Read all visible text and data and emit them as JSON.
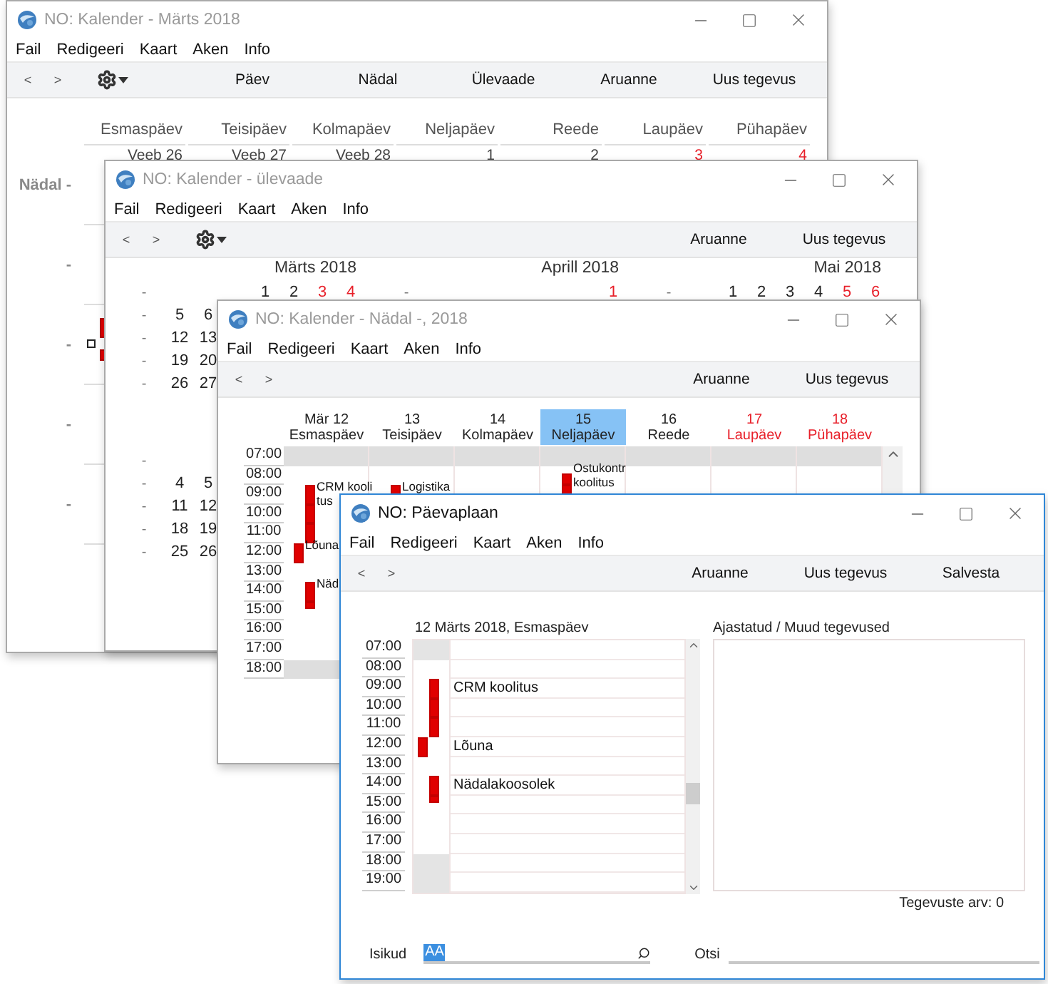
{
  "month_window": {
    "title": "NO: Kalender - Märts 2018",
    "active": false,
    "menu": [
      "Fail",
      "Redigeeri",
      "Kaart",
      "Aken",
      "Info"
    ],
    "toolbar": {
      "nav": [
        "<",
        ">"
      ],
      "settings_menu": true,
      "buttons": [
        "Päev",
        "Nädal",
        "Ülevaade",
        "Aruanne",
        "Uus tegevus"
      ]
    },
    "day_headers": [
      "Esmaspäev",
      "Teisipäev",
      "Kolmapäev",
      "Neljapäev",
      "Reede",
      "Laupäev",
      "Pühapäev"
    ],
    "weeks": [
      {
        "label": "Nädal -",
        "has_events": false,
        "cells": [
          {
            "text": "Veeb 26",
            "weekend": false
          },
          {
            "text": "Veeb 27",
            "weekend": false
          },
          {
            "text": "Veeb 28",
            "weekend": false
          },
          {
            "text": "1",
            "weekend": false
          },
          {
            "text": "2",
            "weekend": false
          },
          {
            "text": "3",
            "weekend": true
          },
          {
            "text": "4",
            "weekend": true
          }
        ]
      },
      {
        "label": "-",
        "has_events": false
      },
      {
        "label": "-",
        "has_events": true
      },
      {
        "label": "-",
        "has_events": false
      },
      {
        "label": "-",
        "has_events": false
      }
    ]
  },
  "overview_window": {
    "title": "NO: Kalender - ülevaade",
    "active": false,
    "menu": [
      "Fail",
      "Redigeeri",
      "Kaart",
      "Aken",
      "Info"
    ],
    "toolbar": {
      "nav": [
        "<",
        ">"
      ],
      "settings_menu": true,
      "buttons": [
        "Aruanne",
        "Uus tegevus"
      ]
    },
    "months": [
      {
        "title": "Märts 2018",
        "weeks": [
          {
            "label": "-",
            "days": [
              {
                "text": "1",
                "weekend": false
              },
              {
                "text": "2",
                "weekend": false
              },
              {
                "text": "3",
                "weekend": true
              },
              {
                "text": "4",
                "weekend": true
              }
            ]
          },
          {
            "label": "-",
            "days": [
              {
                "text": "5",
                "weekend": false
              },
              {
                "text": "6",
                "weekend": false
              }
            ]
          },
          {
            "label": "-",
            "days": [
              {
                "text": "12",
                "weekend": false
              },
              {
                "text": "13",
                "weekend": false
              }
            ]
          },
          {
            "label": "-",
            "days": [
              {
                "text": "19",
                "weekend": false
              },
              {
                "text": "20",
                "weekend": false
              }
            ]
          },
          {
            "label": "-",
            "days": [
              {
                "text": "26",
                "weekend": false
              },
              {
                "text": "27",
                "weekend": false
              }
            ]
          }
        ]
      },
      {
        "title": "Aprill 2018",
        "weeks": [
          {
            "label": "-",
            "days": [
              {
                "text": "1",
                "weekend": true
              }
            ]
          }
        ]
      },
      {
        "title": "Mai 2018",
        "weeks": [
          {
            "label": "-",
            "days": [
              {
                "text": "1",
                "weekend": false
              },
              {
                "text": "2",
                "weekend": false
              },
              {
                "text": "3",
                "weekend": false
              },
              {
                "text": "4",
                "weekend": false
              },
              {
                "text": "5",
                "weekend": true
              },
              {
                "text": "6",
                "weekend": true
              }
            ]
          }
        ]
      },
      {
        "weeks": [
          {
            "label": "-"
          },
          {
            "label": "-",
            "days": [
              {
                "text": "4",
                "weekend": false
              },
              {
                "text": "5",
                "weekend": false
              }
            ]
          },
          {
            "label": "-",
            "days": [
              {
                "text": "11",
                "weekend": false
              },
              {
                "text": "12",
                "weekend": false
              }
            ]
          },
          {
            "label": "-",
            "days": [
              {
                "text": "18",
                "weekend": false
              },
              {
                "text": "19",
                "weekend": false
              }
            ]
          },
          {
            "label": "-",
            "days": [
              {
                "text": "25",
                "weekend": false
              },
              {
                "text": "26",
                "weekend": false
              }
            ]
          }
        ]
      }
    ]
  },
  "week_window": {
    "title": "NO: Kalender - Nädal -, 2018",
    "active": false,
    "menu": [
      "Fail",
      "Redigeeri",
      "Kaart",
      "Aken",
      "Info"
    ],
    "toolbar": {
      "nav": [
        "<",
        ">"
      ],
      "settings_menu": false,
      "buttons": [
        "Aruanne",
        "Uus tegevus"
      ]
    },
    "times": [
      {
        "time": "07:00",
        "shaded": true
      },
      {
        "time": "08:00",
        "shaded": false
      },
      {
        "time": "09:00",
        "shaded": false
      },
      {
        "time": "10:00",
        "shaded": false
      },
      {
        "time": "11:00",
        "shaded": false
      },
      {
        "time": "12:00",
        "shaded": false
      },
      {
        "time": "13:00",
        "shaded": false
      },
      {
        "time": "14:00",
        "shaded": false
      },
      {
        "time": "15:00",
        "shaded": false
      },
      {
        "time": "16:00",
        "shaded": false
      },
      {
        "time": "17:00",
        "shaded": false
      },
      {
        "time": "18:00",
        "shaded": true
      }
    ],
    "days": [
      {
        "date": "Mär 12",
        "name": "Esmaspäev",
        "weekend": false,
        "selected": false,
        "slots": [
          {
            "kind": "none"
          },
          {
            "kind": "none"
          },
          {
            "kind": "full",
            "lines": [
              "CRM kooli",
              "tus"
            ]
          },
          {
            "kind": "full"
          },
          {
            "kind": "full"
          },
          {
            "kind": "side",
            "lines": [
              "Lõuna"
            ]
          },
          {
            "kind": "none"
          },
          {
            "kind": "full",
            "lines": [
              "Näd"
            ]
          },
          {
            "kind": "top"
          }
        ]
      },
      {
        "date": "13",
        "name": "Teisipäev",
        "weekend": false,
        "selected": false,
        "slots": [
          {
            "kind": "none"
          },
          {
            "kind": "none"
          },
          {
            "kind": "upper",
            "lines": [
              "Logistika"
            ]
          }
        ]
      },
      {
        "date": "14",
        "name": "Kolmapäev",
        "weekend": false,
        "selected": false
      },
      {
        "date": "15",
        "name": "Neljapäev",
        "weekend": false,
        "selected": true,
        "slots": [
          {
            "kind": "none"
          },
          {
            "kind": "bottom",
            "lines": [
              "Ostukontr",
              "koolitus"
            ]
          },
          {
            "kind": "upper"
          }
        ]
      },
      {
        "date": "16",
        "name": "Reede",
        "weekend": false,
        "selected": false
      },
      {
        "date": "17",
        "name": "Laupäev",
        "weekend": true,
        "selected": false
      },
      {
        "date": "18",
        "name": "Pühapäev",
        "weekend": true,
        "selected": false
      }
    ]
  },
  "day_window": {
    "title": "NO: Päevaplaan",
    "active": true,
    "menu": [
      "Fail",
      "Redigeeri",
      "Kaart",
      "Aken",
      "Info"
    ],
    "toolbar": {
      "nav": [
        "<",
        ">"
      ],
      "settings_menu": false,
      "buttons": [
        "Aruanne",
        "Uus tegevus",
        "Salvesta"
      ]
    },
    "date_label": "12 Märts 2018, Esmaspäev",
    "rows": [
      {
        "time": "07:00",
        "shaded": true,
        "kind": "none"
      },
      {
        "time": "08:00",
        "shaded": false,
        "kind": "none"
      },
      {
        "time": "09:00",
        "shaded": false,
        "kind": "full",
        "label": "CRM koolitus"
      },
      {
        "time": "10:00",
        "shaded": false,
        "kind": "full"
      },
      {
        "time": "11:00",
        "shaded": false,
        "kind": "full"
      },
      {
        "time": "12:00",
        "shaded": false,
        "kind": "side",
        "label": "Lõuna"
      },
      {
        "time": "13:00",
        "shaded": false,
        "kind": "none"
      },
      {
        "time": "14:00",
        "shaded": false,
        "kind": "full",
        "label": "Nädalakoosolek"
      },
      {
        "time": "15:00",
        "shaded": false,
        "kind": "top"
      },
      {
        "time": "16:00",
        "shaded": false,
        "kind": "none"
      },
      {
        "time": "17:00",
        "shaded": false,
        "kind": "none"
      },
      {
        "time": "18:00",
        "shaded": true,
        "kind": "none"
      },
      {
        "time": "19:00",
        "shaded": true,
        "kind": "none"
      }
    ],
    "side_panel": {
      "title": "Ajastatud / Muud tegevused",
      "count": "Tegevuste arv: 0"
    },
    "persons": {
      "label": "Isikud",
      "value": "AA"
    },
    "search": {
      "label": "Otsi"
    }
  }
}
